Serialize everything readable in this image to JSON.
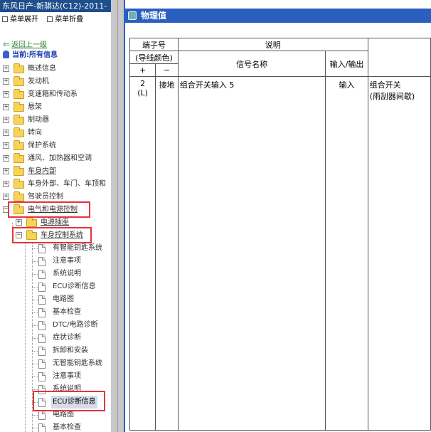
{
  "window_title": "东风日产-新骐达(C12)-2011-",
  "menu": {
    "expand": "菜单展开",
    "collapse": "菜单折叠"
  },
  "nav": {
    "back": "返回上一级",
    "current": "当前:所有信息"
  },
  "tree": [
    {
      "label": "概述信息"
    },
    {
      "label": "发动机"
    },
    {
      "label": "变速箱和传动系"
    },
    {
      "label": "悬架"
    },
    {
      "label": "制动器"
    },
    {
      "label": "转向"
    },
    {
      "label": "保护系统"
    },
    {
      "label": "通风、加热器和空调"
    },
    {
      "label": "车身内部"
    },
    {
      "label": "车身外部、车门、车顶和"
    },
    {
      "label": "驾驶员控制"
    },
    {
      "label": "电气和电源控制"
    },
    {
      "label": "电源插座"
    },
    {
      "label": "车身控制系统"
    },
    {
      "label": "有智能钥匙系统"
    },
    {
      "label": "注意事项"
    },
    {
      "label": "系统说明"
    },
    {
      "label": "ECU诊断信息"
    },
    {
      "label": "电路图"
    },
    {
      "label": "基本检查"
    },
    {
      "label": "DTC/电路诊断"
    },
    {
      "label": "症状诊断"
    },
    {
      "label": "拆卸和安装"
    },
    {
      "label": "无智能钥匙系统"
    },
    {
      "label": "注意事项"
    },
    {
      "label": "系统说明"
    },
    {
      "label": "ECU诊断信息"
    },
    {
      "label": "电路图"
    },
    {
      "label": "基本检查"
    }
  ],
  "panel_title": "物理值",
  "table": {
    "h_terminal_1": "端子号",
    "h_terminal_2": "(导线颜色)",
    "h_desc": "说明",
    "h_plus": "+",
    "h_minus": "−",
    "h_signal": "信号名称",
    "h_io": "输入/输出",
    "row": {
      "plus_1": "2",
      "plus_2": "(L)",
      "minus": "接地",
      "signal": "组合开关输入 5",
      "io": "输入",
      "cond_1": "组合开关",
      "cond_2": "(雨刮器间歇)"
    }
  },
  "colors": {
    "title_bar": "#1f4e8c",
    "header_blue": "#2a5fbf",
    "highlight_red": "#e8323c",
    "link_green": "#2e7d2e"
  }
}
